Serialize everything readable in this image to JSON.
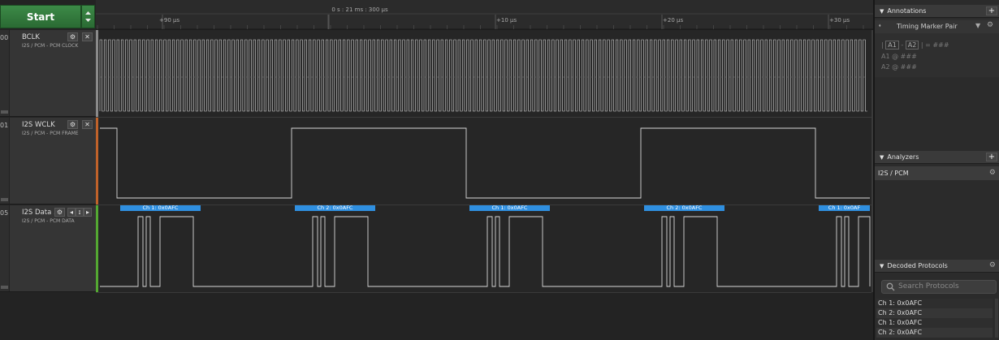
{
  "start_label": "Start",
  "time_header": "0 s : 21 ms : 300 µs",
  "ticks": [
    "+90 µs",
    "+10 µs",
    "+20 µs",
    "+30 µs"
  ],
  "channels": [
    {
      "num": "00",
      "name": "BCLK",
      "sub": "I2S / PCM - PCM CLOCK",
      "color": "#8a8a8a"
    },
    {
      "num": "01",
      "name": "I2S WCLK",
      "sub": "I2S / PCM - PCM FRAME",
      "color": "#c0622a"
    },
    {
      "num": "05",
      "name": "I2S Data ...",
      "sub": "I2S / PCM - PCM DATA",
      "color": "#54a832"
    }
  ],
  "decode_labels": [
    "Ch 1: 0x0AFC",
    "Ch 2: 0x0AFC",
    "Ch 1: 0x0AFC",
    "Ch 2: 0x0AFC",
    "Ch 1: 0x0AF"
  ],
  "annotations": {
    "title": "Annotations",
    "marker_pair": "Timing Marker Pair",
    "a1": "A1",
    "a2": "A2",
    "sep": "-",
    "eq": "=",
    "hash": "###",
    "at": "@",
    "a1_line": "A1",
    "a2_line": "A2"
  },
  "analyzers": {
    "title": "Analyzers",
    "items": [
      "I2S / PCM"
    ]
  },
  "decoded": {
    "title": "Decoded Protocols",
    "search_placeholder": "Search Protocols",
    "rows": [
      "Ch 1: 0x0AFC",
      "Ch 2: 0x0AFC",
      "Ch 1: 0x0AFC",
      "Ch 2: 0x0AFC"
    ]
  },
  "colors": {
    "accent_green": "#3c8a47",
    "decode_blue": "#2f8fe0",
    "signal": "#d8d8d8"
  }
}
